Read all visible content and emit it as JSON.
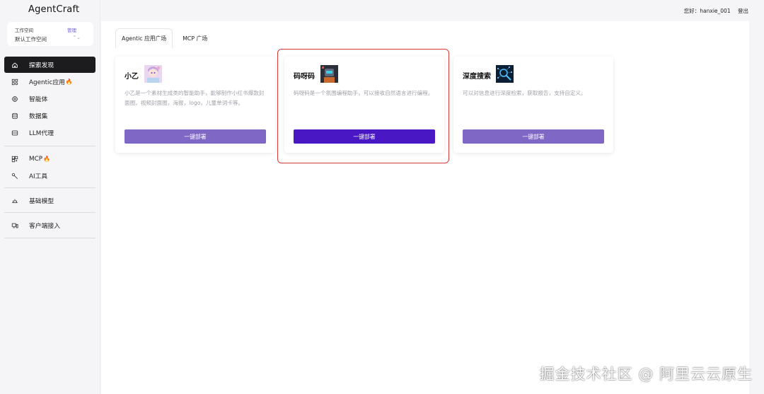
{
  "app": {
    "title": "AgentCraft"
  },
  "workspace": {
    "label": "工作空间",
    "manage": "管理",
    "current": "默认工作空间"
  },
  "nav": {
    "items": [
      {
        "label": "探索发现",
        "icon": "home-icon",
        "active": true
      },
      {
        "label": "Agentic应用",
        "icon": "apps-grid-icon",
        "fire": "🔥"
      },
      {
        "label": "智能体",
        "icon": "agent-icon"
      },
      {
        "label": "数据集",
        "icon": "database-icon"
      },
      {
        "label": "LLM代理",
        "icon": "proxy-icon"
      }
    ],
    "group2": [
      {
        "label": "MCP",
        "icon": "mcp-icon",
        "fire": "🔥"
      },
      {
        "label": "AI工具",
        "icon": "wrench-icon"
      }
    ],
    "group3": [
      {
        "label": "基础模型",
        "icon": "model-icon"
      }
    ],
    "group4": [
      {
        "label": "客户端接入",
        "icon": "client-icon"
      }
    ]
  },
  "header": {
    "greeting": "您好：",
    "username": "hanxie_001",
    "logout": "登出"
  },
  "tabs": [
    {
      "label": "Agentic 应用广场",
      "active": true
    },
    {
      "label": "MCP 广场",
      "active": false
    }
  ],
  "cards": [
    {
      "title": "小乙",
      "description": "小乙是一个素材生成类的智能助手，能够制作小红书爆款封面图，视频封面图，海报，logo，儿童单词卡等。",
      "button": "一键部署",
      "thumb_icon": "anime-avatar-icon"
    },
    {
      "title": "码呀码",
      "description": "码呀码是一个氛围编程助手，可以接收自然语言进行编程。",
      "button": "一键部署",
      "thumb_icon": "robot-avatar-icon",
      "highlighted": true
    },
    {
      "title": "深度搜索",
      "description": "可以对信息进行深度检索，获取报告，支持自定义。",
      "button": "一键部署",
      "thumb_icon": "search-network-icon"
    }
  ],
  "watermark": "掘金技术社区 @ 阿里云云原生",
  "colors": {
    "accent": "#7f67c6",
    "primary_button": "#4a17c4",
    "active_nav": "#1c1c1f",
    "highlight": "#d83a3a"
  }
}
